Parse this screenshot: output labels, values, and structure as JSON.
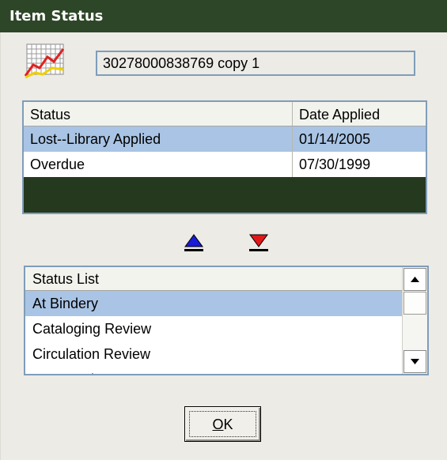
{
  "window": {
    "title": "Item Status"
  },
  "item": {
    "id_text": "30278000838769 copy 1"
  },
  "status_grid": {
    "columns": [
      "Status",
      "Date Applied"
    ],
    "rows": [
      {
        "status": "Lost--Library Applied",
        "date": "01/14/2005",
        "selected": true
      },
      {
        "status": "Overdue",
        "date": "07/30/1999",
        "selected": false
      }
    ]
  },
  "status_list": {
    "header": "Status List",
    "items": [
      "At Bindery",
      "Cataloging Review",
      "Circulation Review",
      "Damaged"
    ],
    "selected": "At Bindery"
  },
  "ok_button": {
    "mnemonic": "O",
    "rest": "K"
  },
  "colors": {
    "title_bar": "#2e4628",
    "selection": "#a9c4e4",
    "grid_empty": "#25391f",
    "border": "#7f9db9"
  },
  "icons": [
    "chart-icon",
    "move-up-icon",
    "move-down-icon",
    "scroll-up-icon",
    "scroll-down-icon"
  ]
}
